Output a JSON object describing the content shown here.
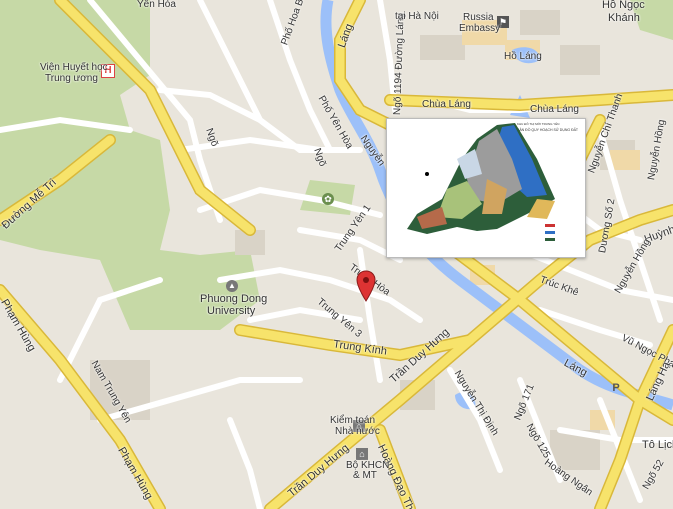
{
  "map": {
    "colors": {
      "background": "#e9e5dc",
      "major_road": "#f7e36b",
      "major_road_edge": "#d9b83a",
      "minor_road": "#ffffff",
      "park": "#c6d9a6",
      "water": "#9cc0f9",
      "building": "#d9d3c7",
      "marker": "#d33"
    },
    "labels": {
      "ten_hoa": "Yên Hòa",
      "pho_hoa_bang": "Phố Hoa Bằng",
      "lang_top": "Láng",
      "ngo_1194": "Ngõ 1194 Đường Láng",
      "tai_ha_noi": "tại Hà Nội",
      "russia_embassy_1": "Russia",
      "russia_embassy_2": "Embassy",
      "ho_ngoc_khanh_1": "Hồ Ngọc",
      "ho_ngoc_khanh_2": "Khánh",
      "vien_huyet_hoc_1": "Viện Huyết học",
      "vien_huyet_hoc_2": "Trung ương",
      "ho_lang": "Hồ Láng",
      "chua_lang_1": "Chùa Láng",
      "chua_lang_2": "Chùa Láng",
      "pho_yen_hoa": "Phố Yên Hòa",
      "nguyen_chi_thanh": "Nguyễn Chí Thanh",
      "nguyen_hong_top": "Nguyễn Hồng",
      "ngo_left": "Ngõ",
      "ngo_mid": "Ngõ",
      "nguyen_truncated": "Nguyễn",
      "duong_me_tri": "Đường Mễ Trì",
      "trung_yen_1": "Trung Yên 1",
      "trung_hoa": "Trung Hòa",
      "trung_yen_3": "Trung Yên 3",
      "phuong_dong_1": "Phuong Dong",
      "phuong_dong_2": "University",
      "duong_so_2": "Dương Số 2",
      "huynh": "Huỳnh",
      "truc_khe": "Trúc Khê",
      "nguyen_hong_right": "Nguyễn Hồng",
      "pham_hung_top": "Phạm Hùng",
      "trung_kinh": "Trung Kính",
      "tran_duy_hung_mid": "Trần Duy Hưng",
      "vu_ngoc_phan": "Vũ Ngọc Phan",
      "lang_right": "Láng",
      "lang_ha": "Láng Hạ",
      "nam_trung_yen": "Nam Trung Yên",
      "nguyen_thi_dinh": "Nguyễn Thị Định",
      "ngo_171": "Ngõ 171",
      "kiem_toan_1": "Kiểm toán",
      "kiem_toan_2": "Nhà nước",
      "ngo_125": "Ngõ 125",
      "to_lich": "Tô Lịch",
      "pham_hung_bottom": "Phạm Hùng",
      "tran_duy_hung_bottom": "Trần Duy Hưng",
      "hoang_dao_thuy": "Hoàng Đạo Thuý",
      "bo_khcn_1": "Bộ KHCN",
      "bo_khcn_2": "& MT",
      "hoang_ngan": "Hoàng Ngân",
      "ngo_52": "Ngõ 52",
      "hospital_letter": "H",
      "parking_letter": "P"
    },
    "inset": {
      "title_line1": "KHU ĐÔ THỊ MỚI TRUNG YÊN",
      "title_line2": "BẢN ĐỒ QUY HOẠCH SỬ DỤNG ĐẤT"
    }
  }
}
